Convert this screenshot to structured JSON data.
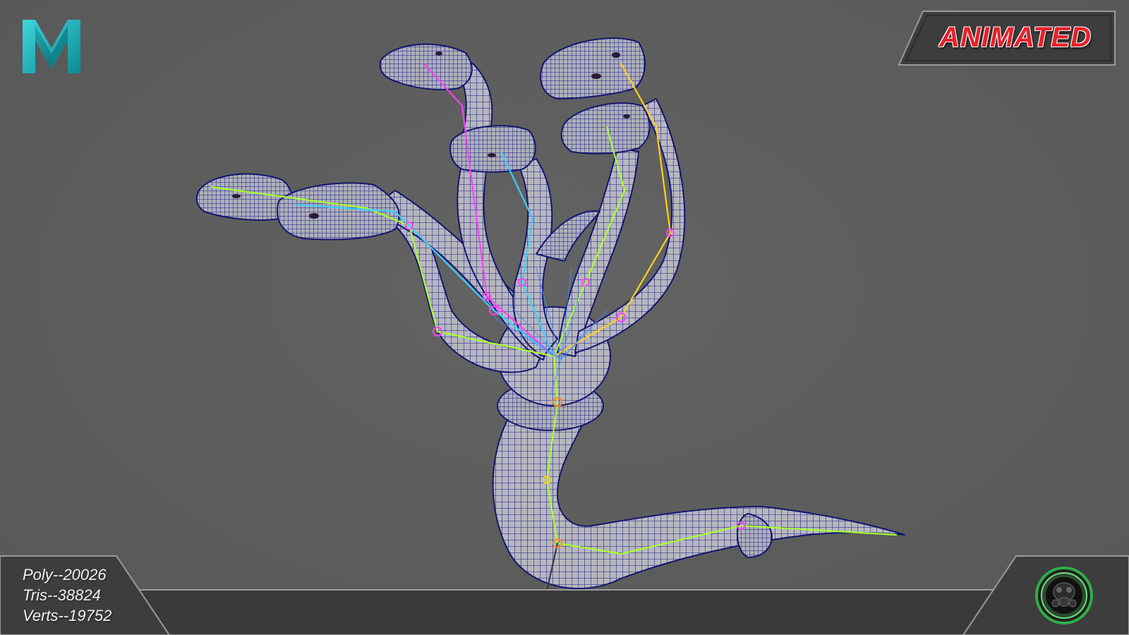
{
  "app": {
    "logo_icon": "maya-m-logo-icon",
    "viewport_bg": "#5e5e5e"
  },
  "badge": {
    "label": "ANIMATED",
    "color": "#e8202a"
  },
  "stats": {
    "poly": "Poly--20026",
    "tris": "Tris--38824",
    "verts": "Verts--19752"
  },
  "emblem": {
    "icon": "gas-mask-emblem-icon",
    "ring_color": "#2fae48"
  },
  "model": {
    "subject": "hydra-wireframe-icon",
    "wire_color": "#1a1a8c",
    "joint_colors": [
      "#ff40ff",
      "#3ad0ff",
      "#a8ff30",
      "#ffd020",
      "#ff8a20"
    ]
  }
}
